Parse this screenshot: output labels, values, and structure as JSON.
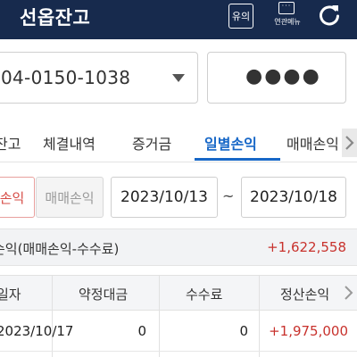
{
  "header": {
    "title": "선옵잔고",
    "info_label": "유의",
    "menu_label": "연관메뉴"
  },
  "account": {
    "number": "04-0150-1038",
    "password_mask": "●●●●"
  },
  "tabs": [
    {
      "label": "잔고"
    },
    {
      "label": "체결내역"
    },
    {
      "label": "증거금"
    },
    {
      "label": "일별손익",
      "active": true
    },
    {
      "label": "매매손익"
    }
  ],
  "filter": {
    "segments": [
      "손익",
      "매매손익"
    ],
    "date_from": "2023/10/13",
    "separator": "~",
    "date_to": "2023/10/18"
  },
  "summary": {
    "label": "손익(매매손익-수수료)",
    "value": "+1,622,558"
  },
  "table": {
    "columns": [
      "일자",
      "약정대금",
      "수수료",
      "정산손익"
    ],
    "rows": [
      {
        "date": "2023/10/17",
        "contract_amount": "0",
        "fee": "0",
        "settlement_pnl": "+1,975,000"
      }
    ]
  },
  "colors": {
    "header_bg": "#172a4d",
    "accent_blue": "#1767c7",
    "profit_red": "#c8322d"
  }
}
